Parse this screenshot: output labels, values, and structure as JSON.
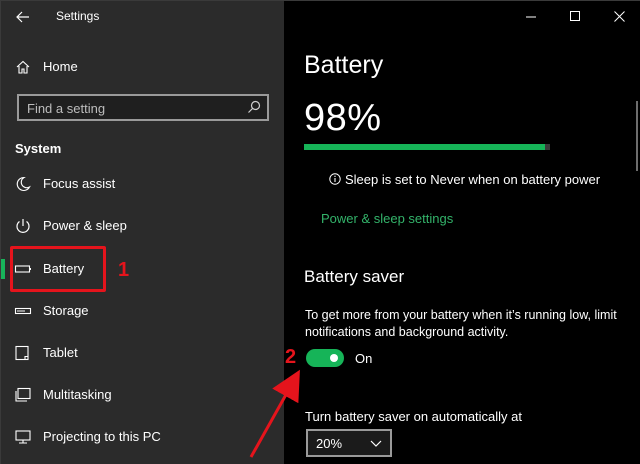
{
  "titlebar": {
    "title": "Settings"
  },
  "sidebar": {
    "home_label": "Home",
    "search_placeholder": "Find a setting",
    "section_label": "System",
    "items": [
      {
        "label": "Focus assist",
        "icon": "moon-icon"
      },
      {
        "label": "Power & sleep",
        "icon": "power-icon"
      },
      {
        "label": "Battery",
        "icon": "battery-icon",
        "active": true
      },
      {
        "label": "Storage",
        "icon": "storage-icon"
      },
      {
        "label": "Tablet",
        "icon": "tablet-icon"
      },
      {
        "label": "Multitasking",
        "icon": "multitasking-icon"
      },
      {
        "label": "Projecting to this PC",
        "icon": "projecting-icon"
      }
    ]
  },
  "main": {
    "title": "Battery",
    "percent_text": "98%",
    "percent_value": 98,
    "sleep_note": "Sleep is set to Never when on battery power",
    "power_link": "Power & sleep settings",
    "saver_heading": "Battery saver",
    "saver_desc": "To get more from your battery when it’s running low, limit notifications and background activity.",
    "toggle_state": "On",
    "auto_label": "Turn battery saver on automatically at",
    "auto_value": "20%"
  },
  "annotations": {
    "mark1": "1",
    "mark2": "2"
  },
  "colors": {
    "accent": "#16b458",
    "annotation": "#e5141c",
    "sidebar_bg": "#2b2b2b",
    "main_bg": "#000000"
  }
}
